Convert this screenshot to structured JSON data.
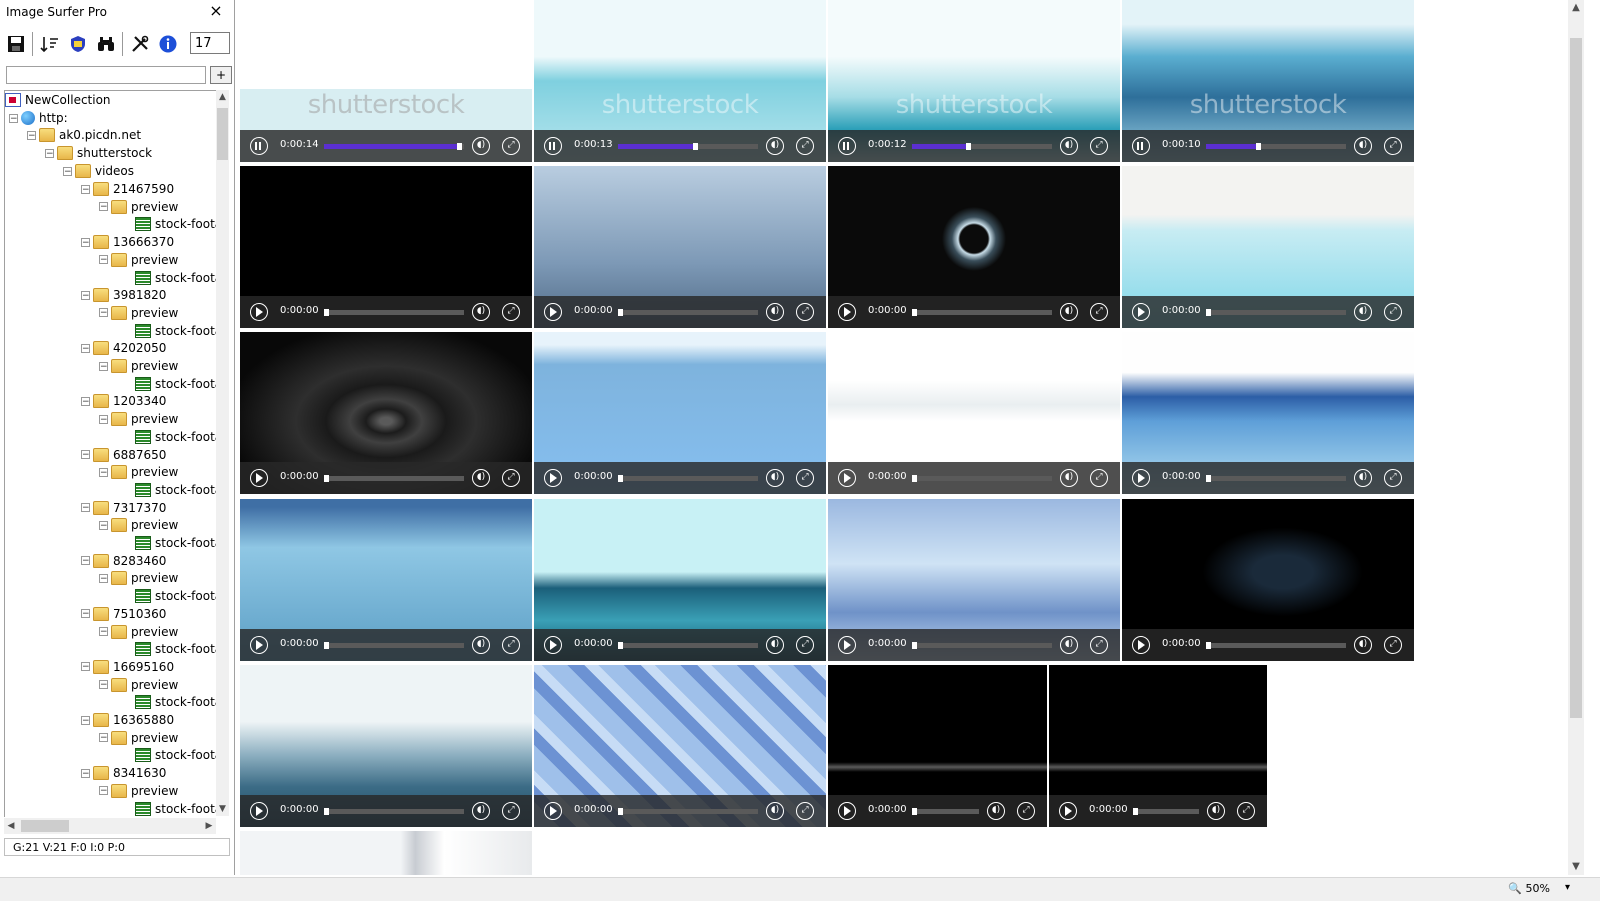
{
  "app": {
    "title": "Image Surfer Pro",
    "close": "×"
  },
  "toolbar": {
    "count_value": "17",
    "add_label": "+"
  },
  "tree": {
    "root": "NewCollection",
    "scheme": "http:",
    "host": "ak0.picdn.net",
    "site": "shutterstock",
    "section": "videos",
    "preview_label": "preview",
    "file_label": "stock-foota",
    "ids": [
      "21467590",
      "13666370",
      "3981820",
      "4202050",
      "1203340",
      "6887650",
      "7317370",
      "8283460",
      "7510360",
      "16695160",
      "16365880",
      "8341630"
    ]
  },
  "sidebar_status": "G:21  V:21  F:0  I:0  P:0",
  "watermark": "shutterstock",
  "videos": [
    {
      "time": "0:00:14",
      "state": "pause",
      "progress": 0.97,
      "kind": "wave-white"
    },
    {
      "time": "0:00:13",
      "state": "pause",
      "progress": 0.56,
      "kind": "wave-cyan"
    },
    {
      "time": "0:00:12",
      "state": "pause",
      "progress": 0.41,
      "kind": "wave-teal"
    },
    {
      "time": "0:00:10",
      "state": "pause",
      "progress": 0.38,
      "kind": "wave-blue"
    },
    {
      "time": "0:00:00",
      "state": "play",
      "progress": 0,
      "kind": "black"
    },
    {
      "time": "0:00:00",
      "state": "play",
      "progress": 0,
      "kind": "drop"
    },
    {
      "time": "0:00:00",
      "state": "play",
      "progress": 0,
      "kind": "ring"
    },
    {
      "time": "0:00:00",
      "state": "play",
      "progress": 0,
      "kind": "splash-light"
    },
    {
      "time": "0:00:00",
      "state": "play",
      "progress": 0,
      "kind": "ripple-dark"
    },
    {
      "time": "0:00:00",
      "state": "play",
      "progress": 0,
      "kind": "underwater"
    },
    {
      "time": "0:00:00",
      "state": "play",
      "progress": 0,
      "kind": "splash-white"
    },
    {
      "time": "0:00:00",
      "state": "play",
      "progress": 0,
      "kind": "wave-deep"
    },
    {
      "time": "0:00:00",
      "state": "play",
      "progress": 0,
      "kind": "bubbles"
    },
    {
      "time": "0:00:00",
      "state": "play",
      "progress": 0,
      "kind": "pour"
    },
    {
      "time": "0:00:00",
      "state": "play",
      "progress": 0,
      "kind": "flow"
    },
    {
      "time": "0:00:00",
      "state": "play",
      "progress": 0,
      "kind": "spray-black"
    },
    {
      "time": "0:00:00",
      "state": "play",
      "progress": 0,
      "kind": "swirl"
    },
    {
      "time": "0:00:00",
      "state": "play",
      "progress": 0,
      "kind": "ice"
    },
    {
      "time": "0:00:00",
      "state": "play",
      "progress": 0,
      "kind": "thin-wave"
    },
    {
      "time": "0:00:00",
      "state": "play",
      "progress": 0,
      "kind": "thin-wave"
    },
    {
      "time": "",
      "state": "none",
      "progress": 0,
      "kind": "partial"
    }
  ],
  "status": {
    "zoom": "50%",
    "zoom_dropdown": "▾"
  },
  "colors": {
    "progress": "#5b2fd1",
    "controls": "#282828"
  }
}
